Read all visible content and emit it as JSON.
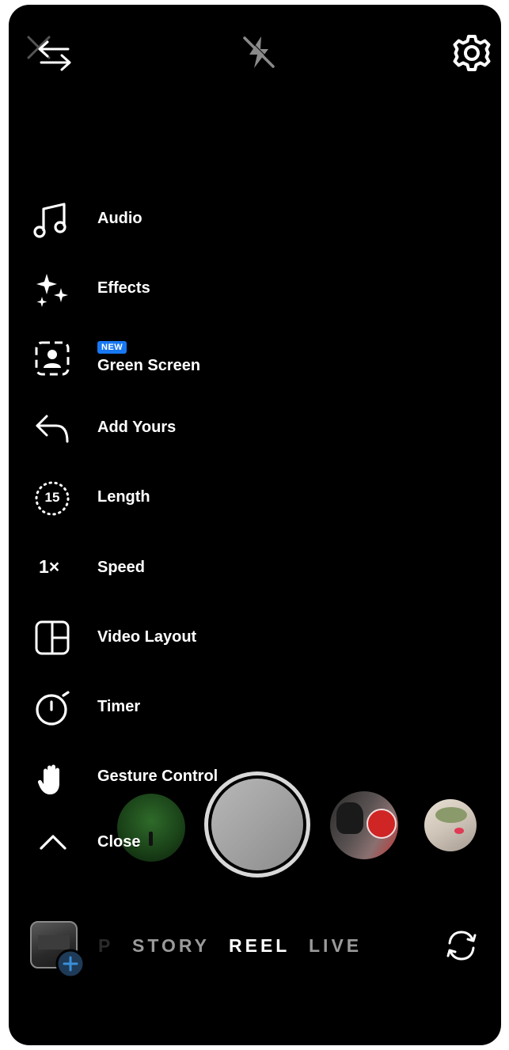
{
  "menu": {
    "items": [
      {
        "label": "Audio",
        "icon": "music-note-icon"
      },
      {
        "label": "Effects",
        "icon": "sparkles-icon"
      },
      {
        "label": "Green Screen",
        "icon": "green-screen-icon",
        "badge": "NEW"
      },
      {
        "label": "Add Yours",
        "icon": "reply-arrow-icon"
      },
      {
        "label": "Length",
        "icon": "length-timer-icon",
        "icon_text": "15"
      },
      {
        "label": "Speed",
        "icon": "speed-icon",
        "icon_text": "1×"
      },
      {
        "label": "Video Layout",
        "icon": "layout-icon"
      },
      {
        "label": "Timer",
        "icon": "stopwatch-icon"
      },
      {
        "label": "Gesture Control",
        "icon": "hand-icon"
      },
      {
        "label": "Close",
        "icon": "chevron-up-icon"
      }
    ]
  },
  "modes": {
    "partial": "P",
    "story": "STORY",
    "reel": "REEL",
    "live": "LIVE"
  },
  "colors": {
    "background": "#000000",
    "badge": "#1877f2",
    "active_mode": "#ffffff",
    "inactive_mode": "#9a9a9a"
  }
}
